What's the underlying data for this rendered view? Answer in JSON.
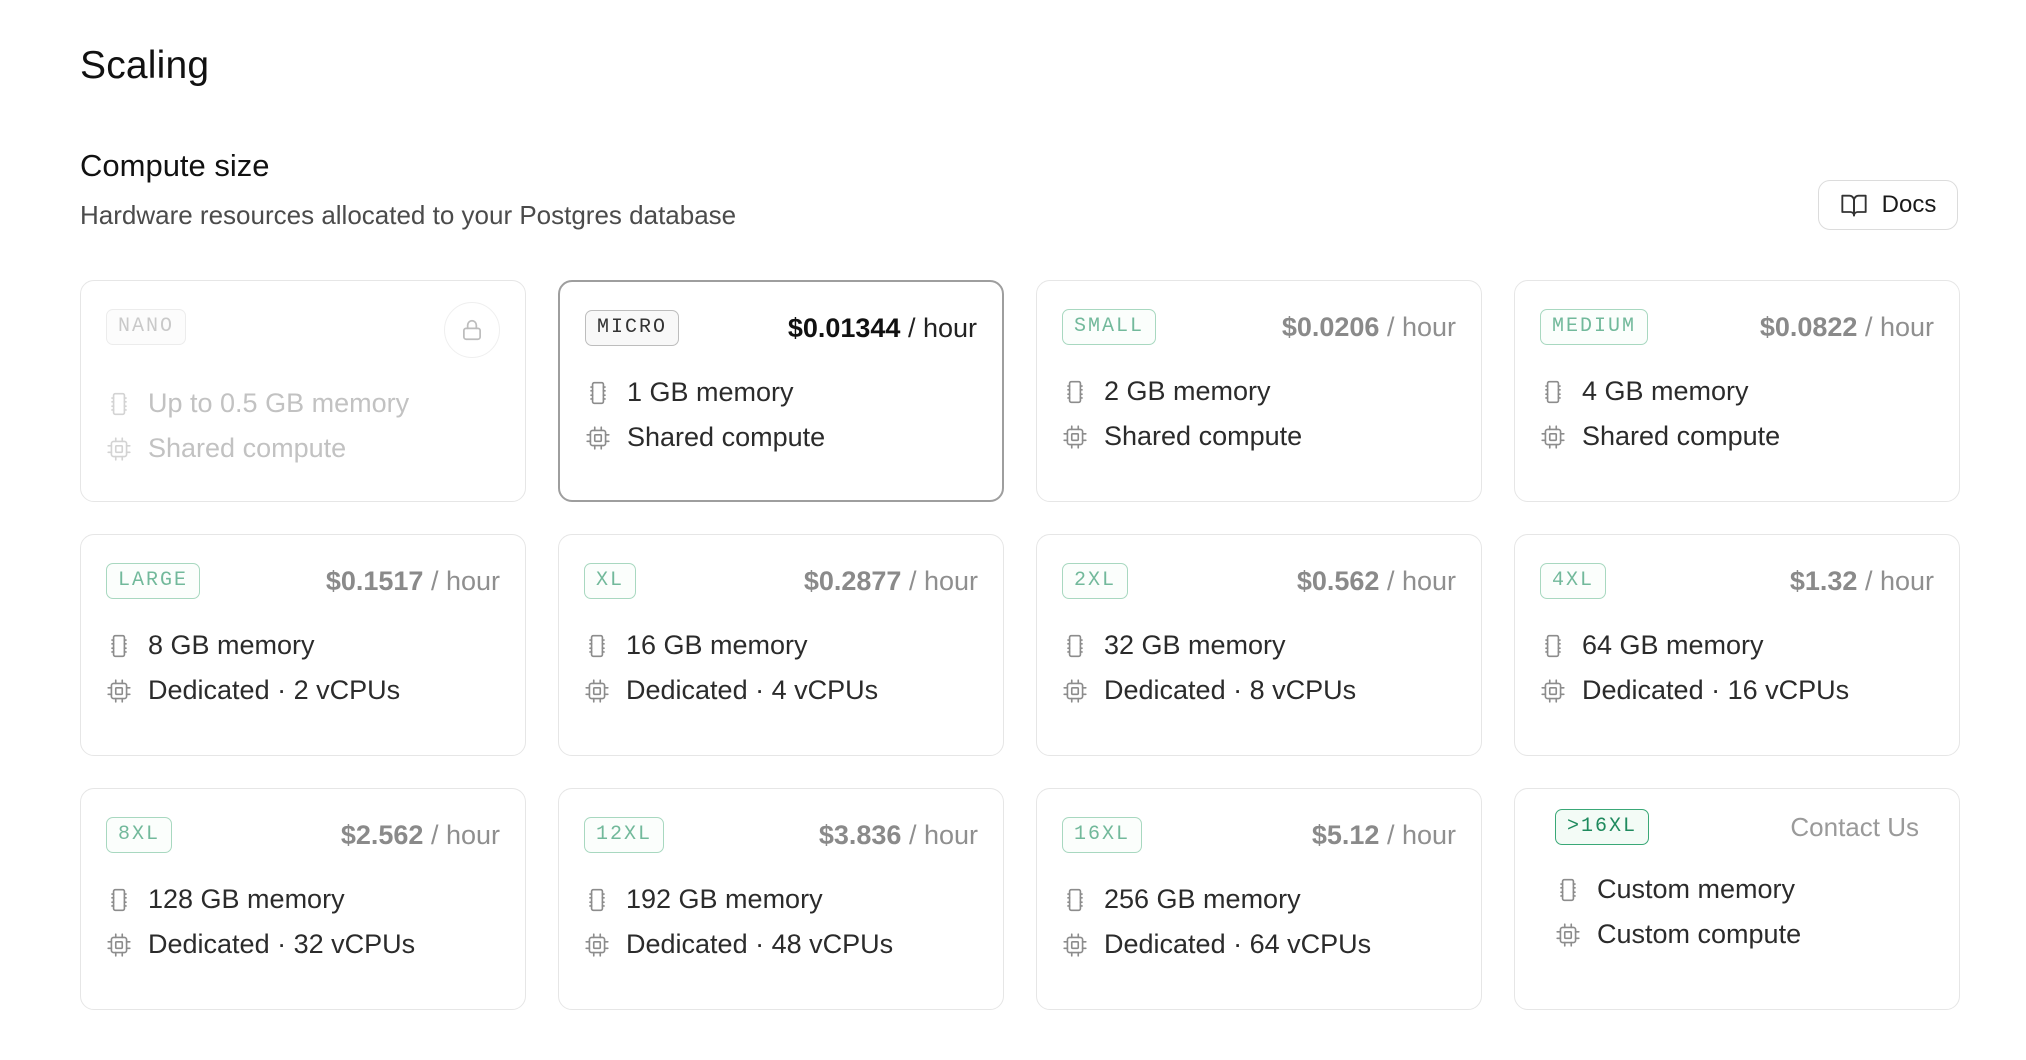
{
  "page": {
    "title": "Scaling"
  },
  "section": {
    "title": "Compute size",
    "description": "Hardware resources allocated to your Postgres database",
    "docs_label": "Docs"
  },
  "colors": {
    "accent_green": "#3aa877",
    "badge_green": "#72b99b",
    "selected_border": "#9e9e9e"
  },
  "cards": [
    {
      "badge": "NANO",
      "state": "disabled",
      "locked": true,
      "price": "",
      "unit": "",
      "memory": "Up to 0.5 GB memory",
      "compute": "Shared compute"
    },
    {
      "badge": "MICRO",
      "state": "selected",
      "price": "$0.01344",
      "unit": "/ hour",
      "memory": "1 GB memory",
      "compute": "Shared compute"
    },
    {
      "badge": "SMALL",
      "state": "available",
      "price": "$0.0206",
      "unit": "/ hour",
      "memory": "2 GB memory",
      "compute": "Shared compute"
    },
    {
      "badge": "MEDIUM",
      "state": "available",
      "price": "$0.0822",
      "unit": "/ hour",
      "memory": "4 GB memory",
      "compute": "Shared compute"
    },
    {
      "badge": "LARGE",
      "state": "available",
      "price": "$0.1517",
      "unit": "/ hour",
      "memory": "8 GB memory",
      "compute": "Dedicated · 2 vCPUs"
    },
    {
      "badge": "XL",
      "state": "available",
      "price": "$0.2877",
      "unit": "/ hour",
      "memory": "16 GB memory",
      "compute": "Dedicated · 4 vCPUs"
    },
    {
      "badge": "2XL",
      "state": "available",
      "price": "$0.562",
      "unit": "/ hour",
      "memory": "32 GB memory",
      "compute": "Dedicated · 8 vCPUs"
    },
    {
      "badge": "4XL",
      "state": "available",
      "price": "$1.32",
      "unit": "/ hour",
      "memory": "64 GB memory",
      "compute": "Dedicated · 16 vCPUs"
    },
    {
      "badge": "8XL",
      "state": "available",
      "price": "$2.562",
      "unit": "/ hour",
      "memory": "128 GB memory",
      "compute": "Dedicated · 32 vCPUs"
    },
    {
      "badge": "12XL",
      "state": "available",
      "price": "$3.836",
      "unit": "/ hour",
      "memory": "192 GB memory",
      "compute": "Dedicated · 48 vCPUs"
    },
    {
      "badge": "16XL",
      "state": "available",
      "price": "$5.12",
      "unit": "/ hour",
      "memory": "256 GB memory",
      "compute": "Dedicated · 64 vCPUs"
    },
    {
      "badge": ">16XL",
      "state": "custom",
      "contact": "Contact Us",
      "memory": "Custom memory",
      "compute": "Custom compute"
    }
  ],
  "icons": {
    "docs": "book-open-icon",
    "lock": "lock-icon",
    "memory": "memory-stick-icon",
    "compute": "cpu-icon"
  }
}
